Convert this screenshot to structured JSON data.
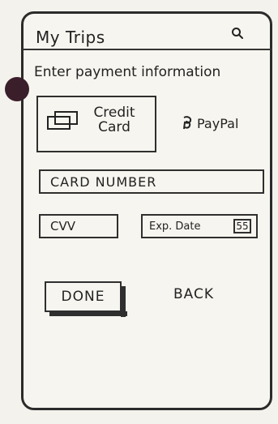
{
  "header": {
    "title": "My Trips",
    "search_icon": "search-icon"
  },
  "payment": {
    "instruction": "Enter payment information",
    "methods": [
      {
        "label": "Credit Card",
        "icon": "credit-card-icon",
        "selected": true
      },
      {
        "label": "PayPal",
        "icon": "paypal-icon",
        "selected": false
      }
    ],
    "fields": {
      "card_number": "CARD NUMBER",
      "cvv": "CVV",
      "expiry_date": "Exp. Date",
      "expiry_value": "55"
    }
  },
  "actions": {
    "done": "DONE",
    "back": "BACK"
  }
}
